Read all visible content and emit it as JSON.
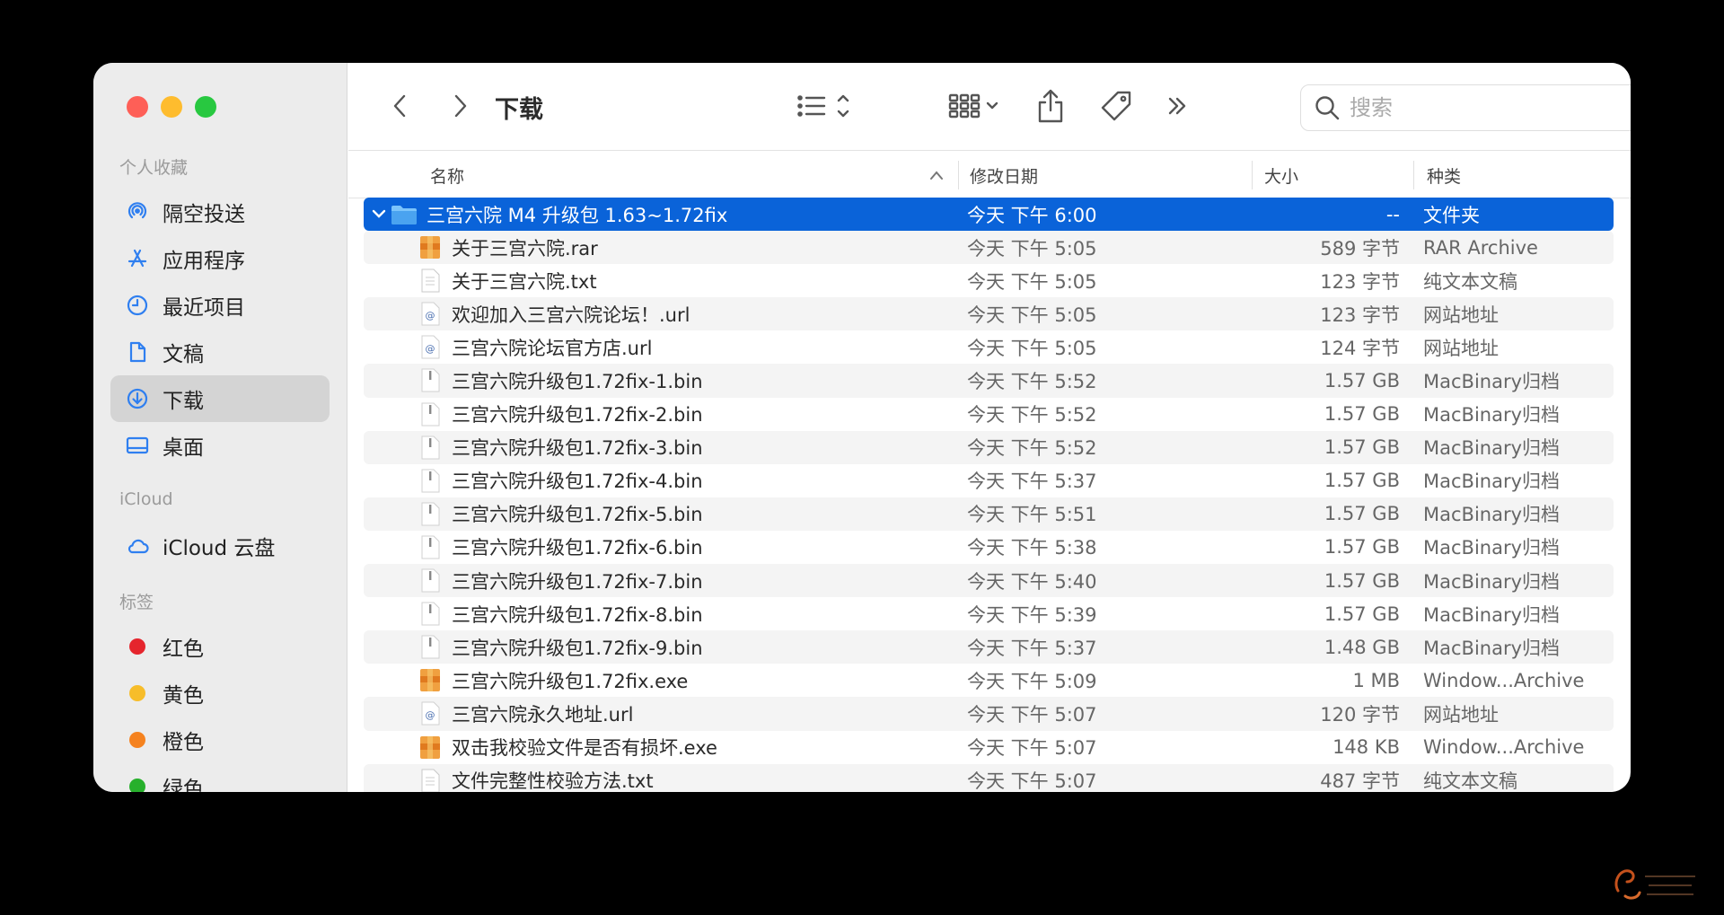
{
  "window": {
    "title": "下载"
  },
  "toolbar": {
    "view_icon": "list-view-icon",
    "group_icon": "icon-grid-icon",
    "share_icon": "share-icon",
    "tag_icon": "tag-icon",
    "more_icon": "chevron-double-right-icon"
  },
  "search": {
    "placeholder": "搜索",
    "value": ""
  },
  "sidebar": {
    "favorites_label": "个人收藏",
    "favorites": [
      {
        "label": "隔空投送",
        "icon": "airdrop-icon"
      },
      {
        "label": "应用程序",
        "icon": "applications-icon"
      },
      {
        "label": "最近项目",
        "icon": "clock-icon"
      },
      {
        "label": "文稿",
        "icon": "document-icon"
      },
      {
        "label": "下载",
        "icon": "download-icon",
        "active": true
      },
      {
        "label": "桌面",
        "icon": "desktop-icon"
      }
    ],
    "icloud_label": "iCloud",
    "icloud": [
      {
        "label": "iCloud 云盘",
        "icon": "cloud-icon"
      }
    ],
    "tags_label": "标签",
    "tags": [
      {
        "label": "红色",
        "color": "#e5252d"
      },
      {
        "label": "黄色",
        "color": "#f7bd2a"
      },
      {
        "label": "橙色",
        "color": "#f5821f"
      },
      {
        "label": "绿色",
        "color": "#27b02c"
      }
    ]
  },
  "columns": {
    "name": "名称",
    "date": "修改日期",
    "size": "大小",
    "kind": "种类"
  },
  "files": [
    {
      "name": "三宫六院 M4 升级包 1.63~1.72fix",
      "date": "今天 下午 6:00",
      "size": "--",
      "kind": "文件夹",
      "type": "folder"
    },
    {
      "name": "关于三宫六院.rar",
      "date": "今天 下午 5:05",
      "size": "589 字节",
      "kind": "RAR Archive",
      "type": "archive"
    },
    {
      "name": "关于三宫六院.txt",
      "date": "今天 下午 5:05",
      "size": "123 字节",
      "kind": "纯文本文稿",
      "type": "text"
    },
    {
      "name": "欢迎加入三宫六院论坛！.url",
      "date": "今天 下午 5:05",
      "size": "123 字节",
      "kind": "网站地址",
      "type": "url"
    },
    {
      "name": "三宫六院论坛官方店.url",
      "date": "今天 下午 5:05",
      "size": "124 字节",
      "kind": "网站地址",
      "type": "url"
    },
    {
      "name": "三宫六院升级包1.72fix-1.bin",
      "date": "今天 下午 5:52",
      "size": "1.57 GB",
      "kind": "MacBinary归档",
      "type": "bin"
    },
    {
      "name": "三宫六院升级包1.72fix-2.bin",
      "date": "今天 下午 5:52",
      "size": "1.57 GB",
      "kind": "MacBinary归档",
      "type": "bin"
    },
    {
      "name": "三宫六院升级包1.72fix-3.bin",
      "date": "今天 下午 5:52",
      "size": "1.57 GB",
      "kind": "MacBinary归档",
      "type": "bin"
    },
    {
      "name": "三宫六院升级包1.72fix-4.bin",
      "date": "今天 下午 5:37",
      "size": "1.57 GB",
      "kind": "MacBinary归档",
      "type": "bin"
    },
    {
      "name": "三宫六院升级包1.72fix-5.bin",
      "date": "今天 下午 5:51",
      "size": "1.57 GB",
      "kind": "MacBinary归档",
      "type": "bin"
    },
    {
      "name": "三宫六院升级包1.72fix-6.bin",
      "date": "今天 下午 5:38",
      "size": "1.57 GB",
      "kind": "MacBinary归档",
      "type": "bin"
    },
    {
      "name": "三宫六院升级包1.72fix-7.bin",
      "date": "今天 下午 5:40",
      "size": "1.57 GB",
      "kind": "MacBinary归档",
      "type": "bin"
    },
    {
      "name": "三宫六院升级包1.72fix-8.bin",
      "date": "今天 下午 5:39",
      "size": "1.57 GB",
      "kind": "MacBinary归档",
      "type": "bin"
    },
    {
      "name": "三宫六院升级包1.72fix-9.bin",
      "date": "今天 下午 5:37",
      "size": "1.48 GB",
      "kind": "MacBinary归档",
      "type": "bin"
    },
    {
      "name": "三宫六院升级包1.72fix.exe",
      "date": "今天 下午 5:09",
      "size": "1 MB",
      "kind": "Window...Archive",
      "type": "exe"
    },
    {
      "name": "三宫六院永久地址.url",
      "date": "今天 下午 5:07",
      "size": "120 字节",
      "kind": "网站地址",
      "type": "url"
    },
    {
      "name": "双击我校验文件是否有损坏.exe",
      "date": "今天 下午 5:07",
      "size": "148 KB",
      "kind": "Window...Archive",
      "type": "exe"
    },
    {
      "name": "文件完整性校验方法.txt",
      "date": "今天 下午 5:07",
      "size": "487 字节",
      "kind": "纯文本文稿",
      "type": "text"
    }
  ],
  "colors": {
    "selection": "#0a63d9",
    "sidebar_bg": "#ececec",
    "folder": "#4aa3f0"
  }
}
